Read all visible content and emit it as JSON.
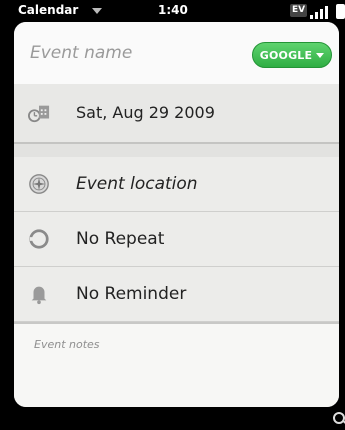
{
  "status_bar": {
    "app_name": "Calendar",
    "time": "1:40",
    "network_badge": "EV",
    "colors": {
      "background": "#000000",
      "text": "#ffffff"
    }
  },
  "event_form": {
    "name_placeholder": "Event name",
    "name_value": "",
    "calendar_button_label": "GOOGLE",
    "calendar_button_color": "#3cbe52",
    "date_label": "Sat, Aug 29 2009",
    "location_label": "Event location",
    "repeat_label": "No Repeat",
    "reminder_label": "No Reminder",
    "notes_placeholder": "Event notes",
    "notes_value": ""
  },
  "icons": {
    "status": [
      "chevron-down-icon",
      "signal-strength-icon",
      "battery-icon"
    ],
    "rows": [
      "calendar-clock-icon",
      "compass-icon",
      "repeat-circle-icon",
      "bell-icon"
    ],
    "corner": "search-icon"
  }
}
